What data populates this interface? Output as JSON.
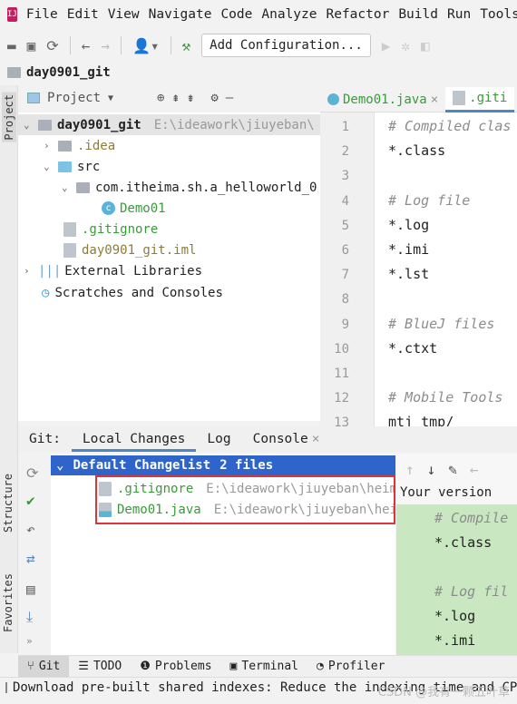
{
  "menu": [
    "File",
    "Edit",
    "View",
    "Navigate",
    "Code",
    "Analyze",
    "Refactor",
    "Build",
    "Run",
    "Tools"
  ],
  "toolbar": {
    "add_configuration": "Add Configuration..."
  },
  "navbar": {
    "project": "day0901_git"
  },
  "stripe": {
    "project": "Project",
    "structure": "Structure",
    "favorites": "Favorites"
  },
  "project_panel": {
    "title": "Project"
  },
  "tree": [
    {
      "label": "day0901_git",
      "path": "E:\\ideawork\\jiuyeban\\"
    },
    {
      "label": ".idea"
    },
    {
      "label": "src"
    },
    {
      "label": "com.itheima.sh.a_helloworld_0"
    },
    {
      "label": "Demo01"
    },
    {
      "label": ".gitignore"
    },
    {
      "label": "day0901_git.iml"
    },
    {
      "label": "External Libraries"
    },
    {
      "label": "Scratches and Consoles"
    }
  ],
  "editor": {
    "tabs": [
      {
        "label": "Demo01.java"
      },
      {
        "label": ".giti"
      }
    ],
    "lines": [
      {
        "n": "1",
        "text": "# Compiled clas",
        "comment": true
      },
      {
        "n": "2",
        "text": "*.class"
      },
      {
        "n": "3",
        "text": ""
      },
      {
        "n": "4",
        "text": "# Log file",
        "comment": true
      },
      {
        "n": "5",
        "text": "*.log"
      },
      {
        "n": "6",
        "text": "*.imi"
      },
      {
        "n": "7",
        "text": "*.lst"
      },
      {
        "n": "8",
        "text": ""
      },
      {
        "n": "9",
        "text": "# BlueJ files",
        "comment": true
      },
      {
        "n": "10",
        "text": "*.ctxt"
      },
      {
        "n": "11",
        "text": ""
      },
      {
        "n": "12",
        "text": "# Mobile Tools",
        "comment": true
      },
      {
        "n": "13",
        "text": "mtj_tmp/"
      }
    ]
  },
  "git": {
    "label": "Git:",
    "tabs": [
      "Local Changes",
      "Log",
      "Console"
    ],
    "changelist": {
      "name": "Default Changelist",
      "count": "2 files"
    },
    "files": [
      {
        "name": ".gitignore",
        "path": "E:\\ideawork\\jiuyeban\\heima"
      },
      {
        "name": "Demo01.java",
        "path": "E:\\ideawork\\jiuyeban\\heim"
      }
    ],
    "diff": {
      "title": "Your version",
      "lines": [
        "# Compile",
        "*.class",
        "",
        "# Log fil",
        "*.log",
        "*.imi"
      ]
    }
  },
  "bottom_tabs": [
    "Git",
    "TODO",
    "Problems",
    "Terminal",
    "Profiler"
  ],
  "status": {
    "message": "Download pre-built shared indexes: Reduce the indexing time and CP"
  },
  "watermark": "CSDN @我有一颗五叶草",
  "colors": {
    "selection": "#2f65ca",
    "highlight_box": "#d9353a",
    "diff_added": "#c9e7c0",
    "added_file": "#3a9a3a"
  }
}
